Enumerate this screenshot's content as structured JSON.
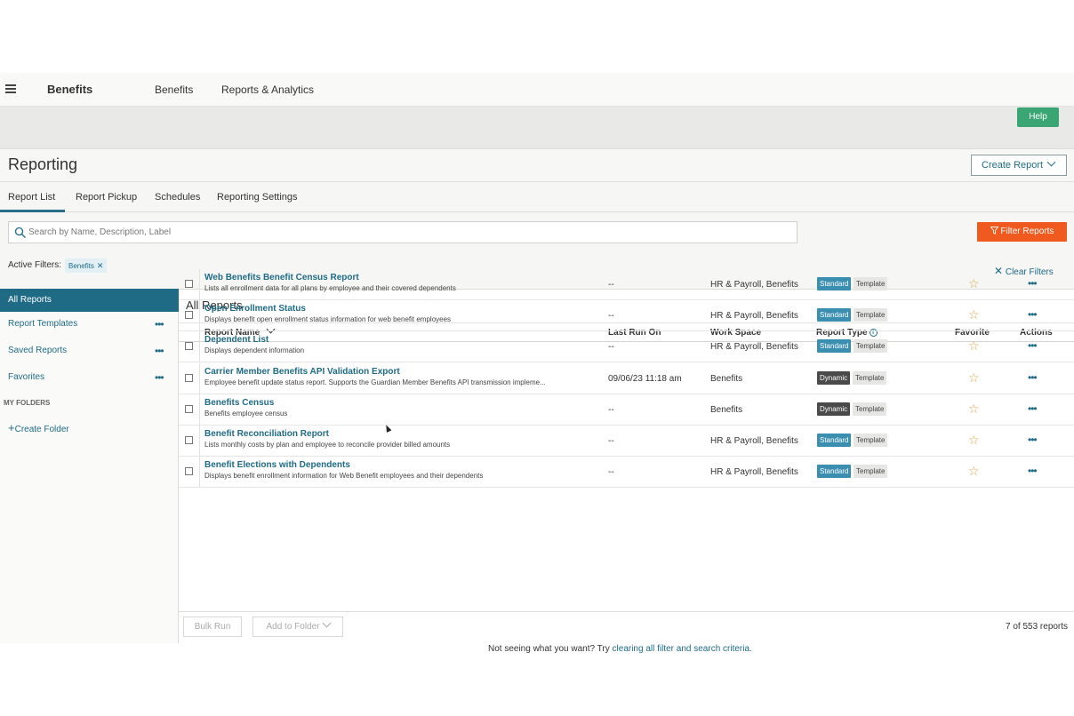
{
  "nav": {
    "brand": "Benefits",
    "links": [
      "Benefits",
      "Reports & Analytics"
    ]
  },
  "help_label": "Help",
  "page": {
    "title": "Reporting",
    "create_label": "Create Report"
  },
  "tabs": [
    "Report List",
    "Report Pickup",
    "Schedules",
    "Reporting Settings"
  ],
  "search": {
    "placeholder": "Search by Name, Description, Label",
    "value": ""
  },
  "filter_label": "Filter Reports",
  "active_filters": {
    "label": "Active Filters:",
    "chip": "Benefits",
    "clear_label": "Clear Filters"
  },
  "sidebar": {
    "active": "All Reports",
    "items": [
      "Report Templates",
      "Saved Reports",
      "Favorites"
    ],
    "section": "MY FOLDERS",
    "create_folder": "Create Folder"
  },
  "main": {
    "title": "All Reports"
  },
  "columns": {
    "name": "Report Name",
    "last_run": "Last Run On",
    "workspace": "Work Space",
    "type": "Report Type",
    "favorite": "Favorite",
    "actions": "Actions"
  },
  "rows": [
    {
      "name": "Web Benefits Benefit Census Report",
      "desc": "Lists all enrollment data for all plans by employee and their covered dependents",
      "last_run": "--",
      "workspace": "HR & Payroll, Benefits",
      "type": "Standard",
      "template": "Template"
    },
    {
      "name": "Open Enrollment Status",
      "desc": "Displays benefit open enrollment status information for web benefit employees",
      "last_run": "--",
      "workspace": "HR & Payroll, Benefits",
      "type": "Standard",
      "template": "Template"
    },
    {
      "name": "Dependent List",
      "desc": "Displays dependent information",
      "last_run": "--",
      "workspace": "HR & Payroll, Benefits",
      "type": "Standard",
      "template": "Template"
    },
    {
      "name": "Carrier Member Benefits API Validation Export",
      "desc": "Employee benefit update status report. Supports the Guardian Member Benefits API transmission impleme...",
      "last_run": "09/06/23 11:18 am",
      "workspace": "Benefits",
      "type": "Dynamic",
      "template": "Template"
    },
    {
      "name": "Benefits Census",
      "desc": "Benefits employee census",
      "last_run": "--",
      "workspace": "Benefits",
      "type": "Dynamic",
      "template": "Template"
    },
    {
      "name": "Benefit Reconciliation Report",
      "desc": "Lists monthly costs by plan and employee to reconcile provider billed amounts",
      "last_run": "--",
      "workspace": "HR & Payroll, Benefits",
      "type": "Standard",
      "template": "Template"
    },
    {
      "name": "Benefit Elections with Dependents",
      "desc": "Displays benefit enrollment information for Web Benefit employees and their dependents",
      "last_run": "--",
      "workspace": "HR & Payroll, Benefits",
      "type": "Standard",
      "template": "Template"
    }
  ],
  "badge_colors": {
    "Standard": "#3a8fb0",
    "Dynamic": "#4a4a4a"
  },
  "not_seeing": {
    "text": "Not seeing what you want? Try ",
    "link": "clearing all filter and search criteria."
  },
  "footer": {
    "bulk_run": "Bulk Run",
    "add_folder": "Add to Folder",
    "count": "7 of 553 reports"
  }
}
